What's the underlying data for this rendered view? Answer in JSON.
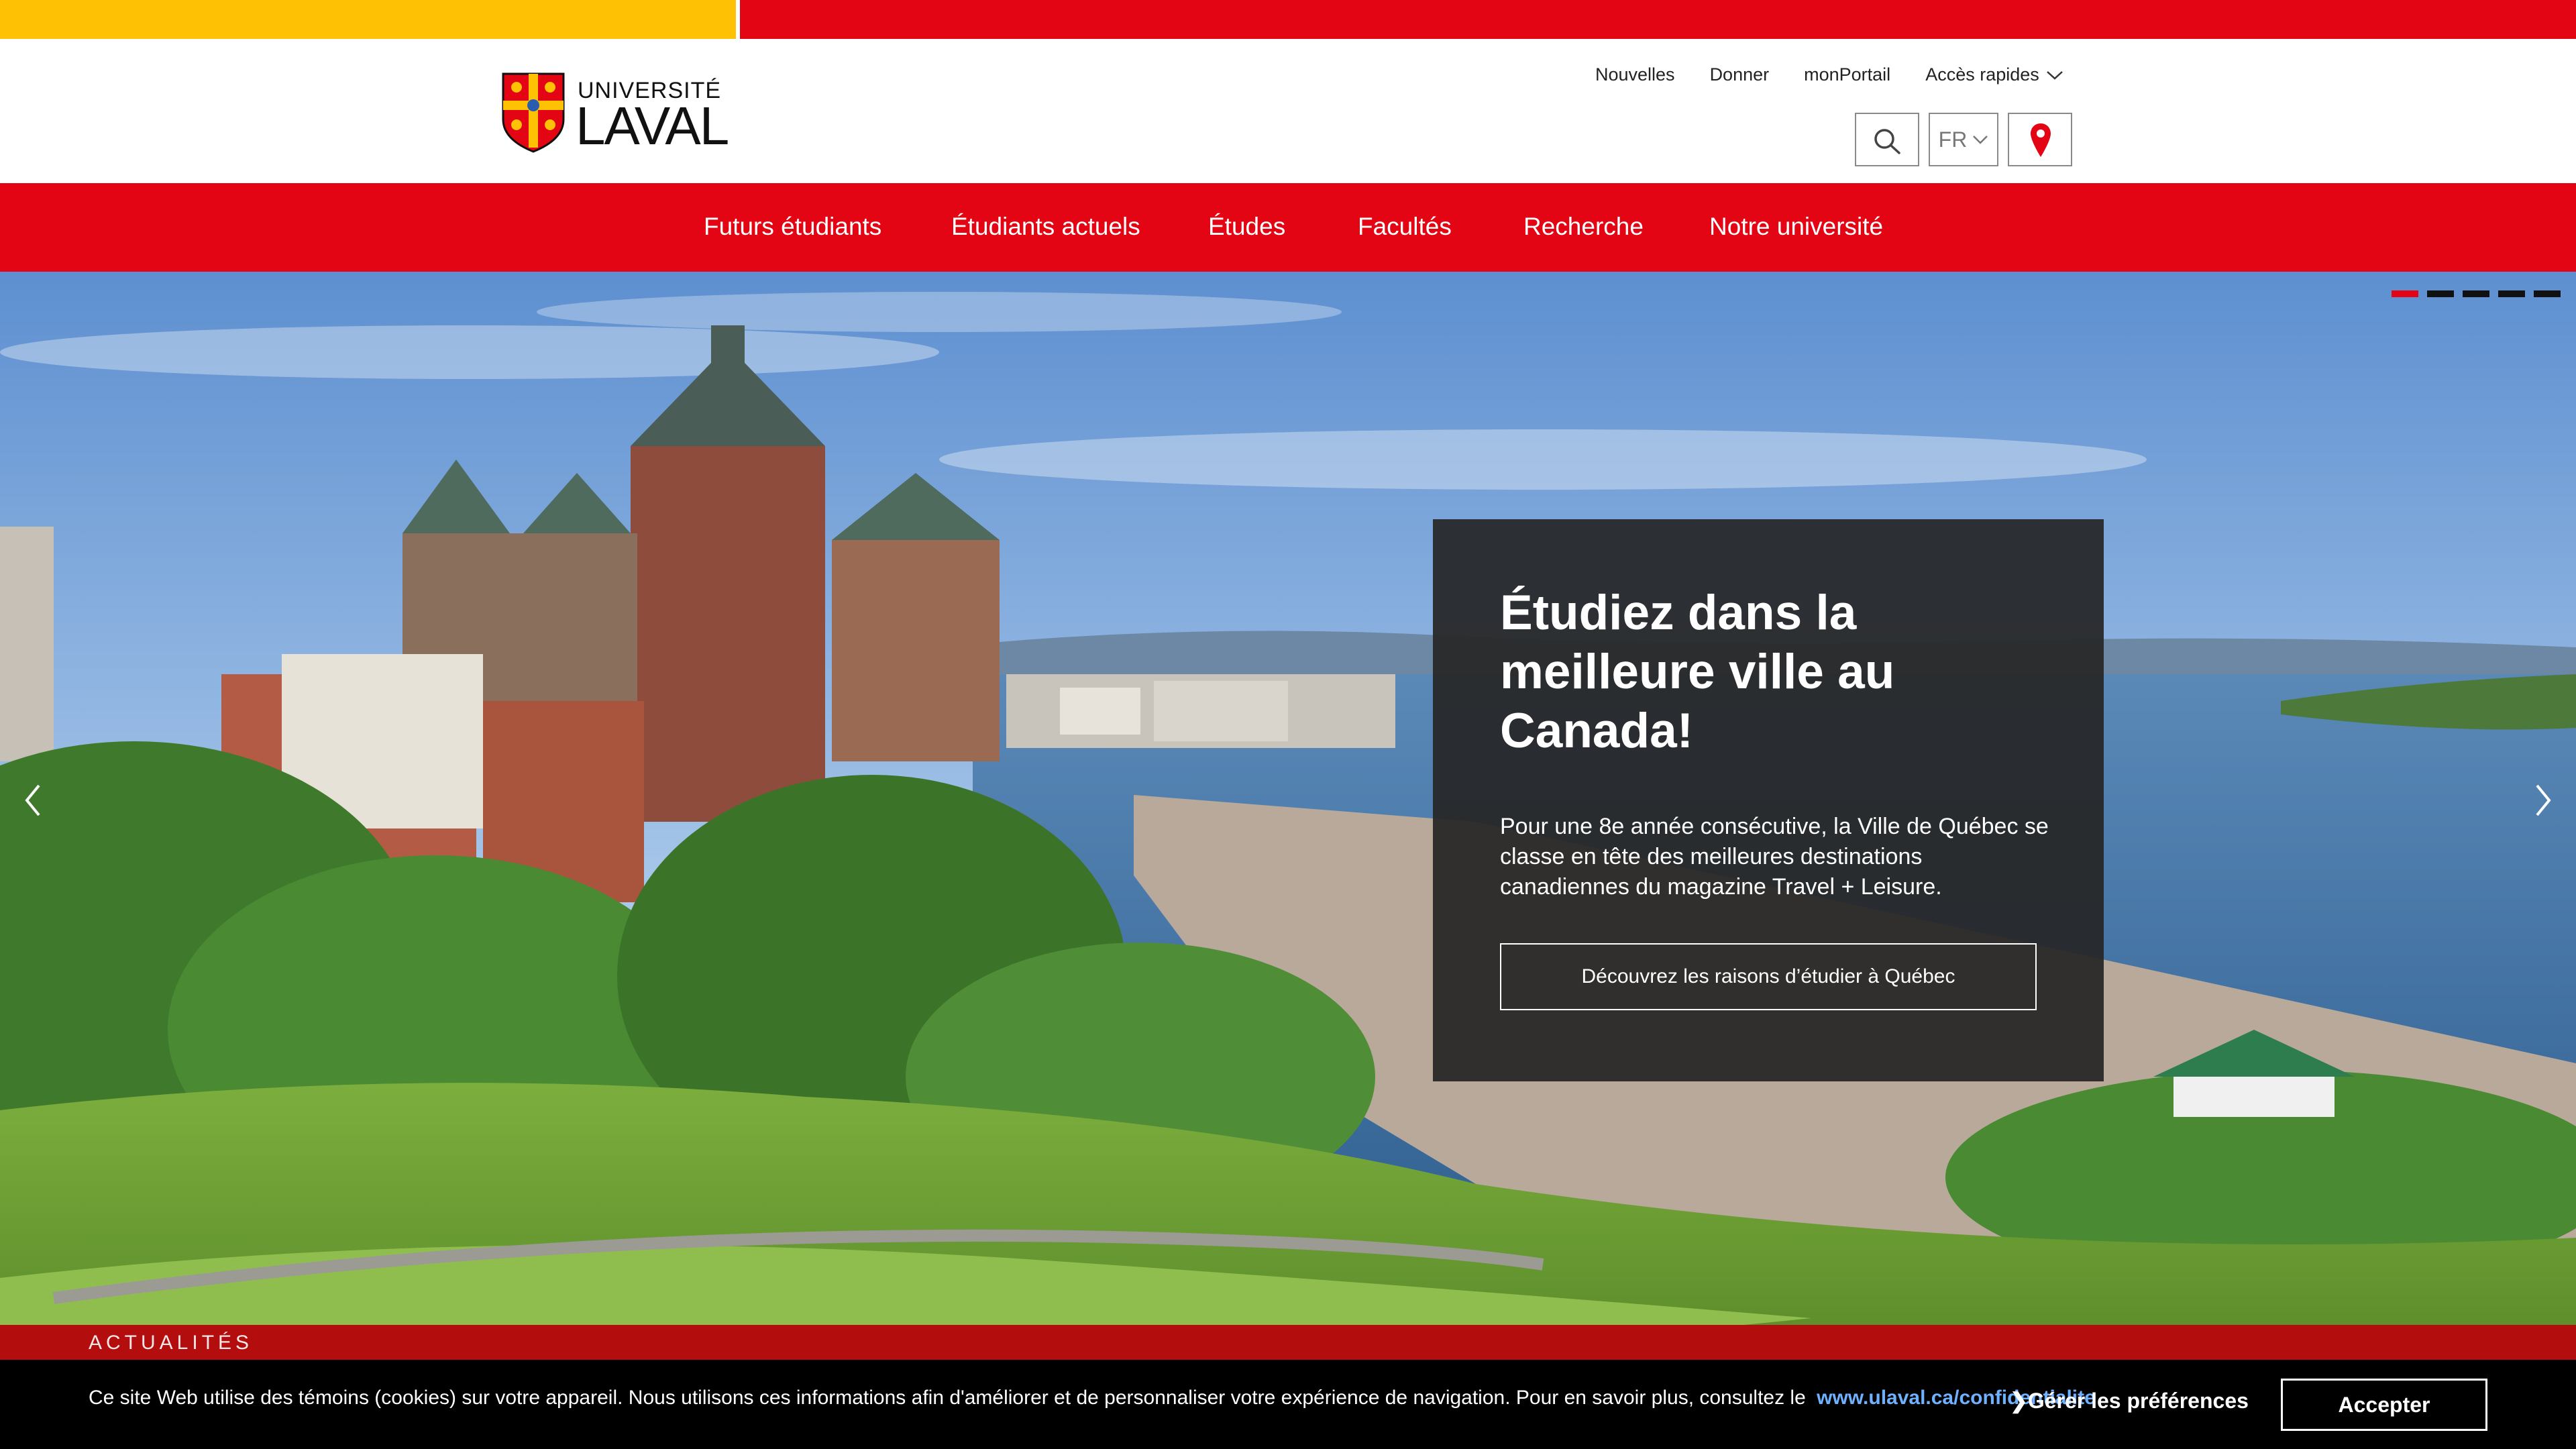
{
  "logo": {
    "line1": "UNIVERSITÉ",
    "line2": "LAVAL"
  },
  "utility_links": [
    "Nouvelles",
    "Donner",
    "monPortail",
    "Accès rapides"
  ],
  "language": {
    "current": "FR"
  },
  "nav": {
    "items": [
      "Futurs étudiants",
      "Étudiants actuels",
      "Études",
      "Facultés",
      "Recherche",
      "Notre université"
    ]
  },
  "hero": {
    "slide_count": 5,
    "active_slide": 1,
    "card": {
      "title": "Étudiez dans la meilleure ville au Canada!",
      "text": "Pour une 8e année consécutive, la Ville de Québec se classe en tête des meilleures destinations canadiennes du magazine Travel + Leisure.",
      "button": "Découvrez les raisons d’étudier à Québec"
    }
  },
  "red_band": {
    "text": "ACTUALITÉS"
  },
  "cookie": {
    "text": "Ce site Web utilise des témoins (cookies) sur votre appareil. Nous utilisons ces informations afin d'améliorer et de personnaliser votre expérience de navigation. Pour en savoir plus, consultez le",
    "link": "www.ulaval.ca/confidentialite",
    "preferences": "❯Gérer les préférences",
    "accept": "Accepter"
  },
  "colors": {
    "brand_red": "#e30513",
    "brand_yellow": "#ffc103",
    "card_bg": "#262626",
    "cookie_link": "#6fb1ff"
  },
  "icons": [
    "search-icon",
    "chevron-down-icon",
    "map-pin-icon",
    "chevron-left-icon",
    "chevron-right-icon",
    "shield-logo-icon"
  ]
}
